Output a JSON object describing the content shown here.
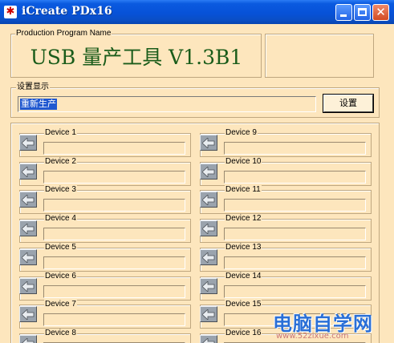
{
  "window": {
    "title": "iCreate PDx16",
    "program_name_legend": "Production Program Name",
    "program_name": "USB 量产工具 V1.3B1",
    "display_legend": "设置显示",
    "display_value": "重新生产",
    "set_button": "设置"
  },
  "devices": [
    {
      "label": "Device 1"
    },
    {
      "label": "Device 2"
    },
    {
      "label": "Device 3"
    },
    {
      "label": "Device 4"
    },
    {
      "label": "Device 5"
    },
    {
      "label": "Device 6"
    },
    {
      "label": "Device 7"
    },
    {
      "label": "Device 8"
    },
    {
      "label": "Device 9"
    },
    {
      "label": "Device 10"
    },
    {
      "label": "Device 11"
    },
    {
      "label": "Device 12"
    },
    {
      "label": "Device 13"
    },
    {
      "label": "Device 14"
    },
    {
      "label": "Device 15"
    },
    {
      "label": "Device 16"
    }
  ],
  "watermark": {
    "text": "电脑自学网",
    "url": "www.52zixue.com"
  },
  "colors": {
    "background": "#fde6bd",
    "titlebar": "#0752d8",
    "program_name": "#1a5c1a",
    "selection": "#2058d0",
    "watermark": "#2a6fd6"
  },
  "icons": {
    "app": "app-icon",
    "device_button": "arrow-left-icon"
  }
}
